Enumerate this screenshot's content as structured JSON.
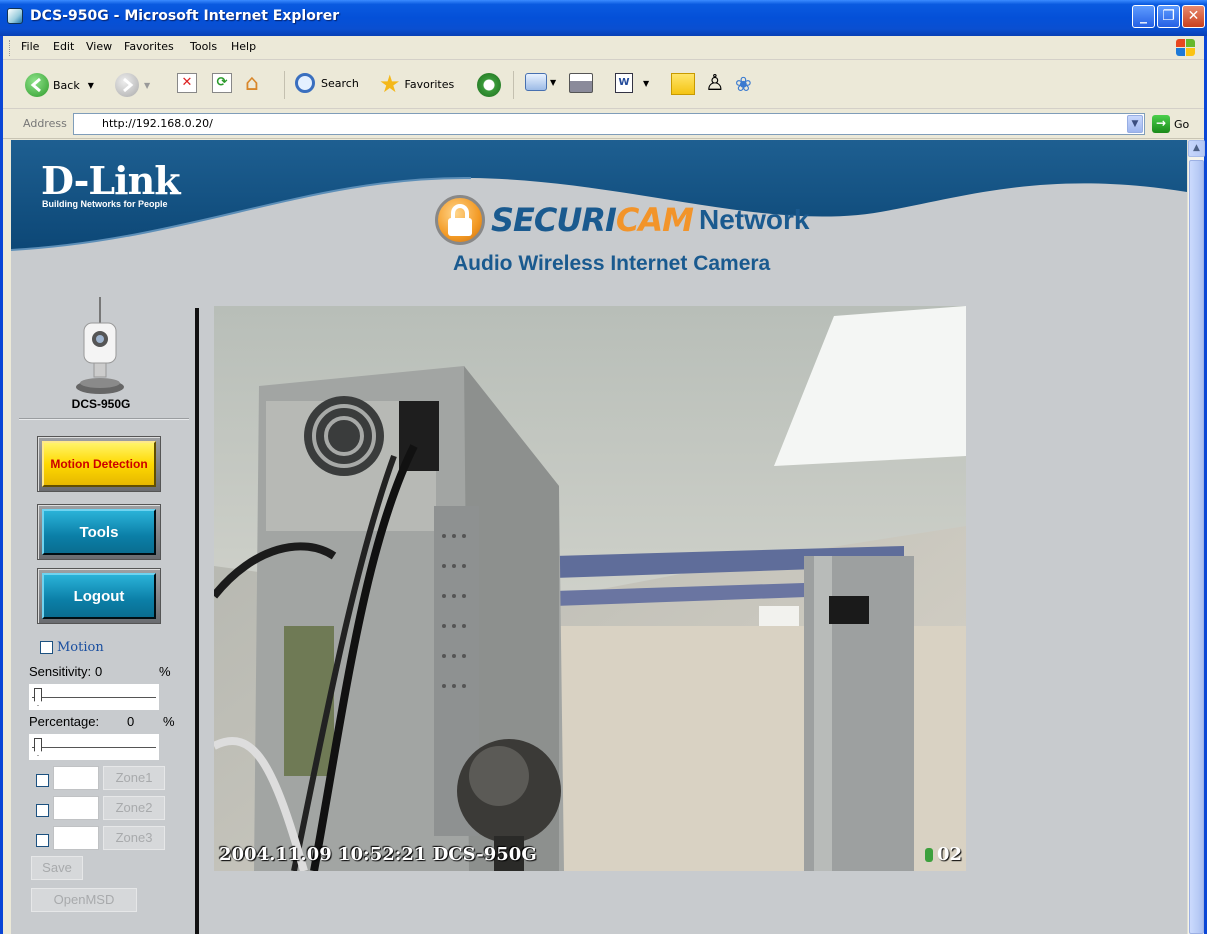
{
  "window": {
    "title": "DCS-950G - Microsoft Internet Explorer"
  },
  "menu": {
    "items": [
      "File",
      "Edit",
      "View",
      "Favorites",
      "Tools",
      "Help"
    ]
  },
  "toolbar": {
    "back_label": "Back",
    "search_label": "Search",
    "favorites_label": "Favorites"
  },
  "address": {
    "label": "Address",
    "url": "http://192.168.0.20/",
    "go_label": "Go"
  },
  "page": {
    "brand": "D-Link",
    "brand_tagline": "Building Networks for People",
    "product_securi": "SECURI",
    "product_cam": "CAM",
    "product_network": "Network",
    "subtitle": "Audio Wireless Internet Camera",
    "model": "DCS-950G"
  },
  "sidebar": {
    "motion_detection_label": "Motion Detection",
    "tools_label": "Tools",
    "logout_label": "Logout",
    "motion_checkbox_label": "Motion",
    "sensitivity_label": "Sensitivity:",
    "sensitivity_value": "0",
    "sensitivity_unit": "%",
    "percentage_label": "Percentage:",
    "percentage_value": "0",
    "percentage_unit": "%",
    "zones": [
      "Zone1",
      "Zone2",
      "Zone3"
    ],
    "save_label": "Save",
    "openmsd_label": "OpenMSD"
  },
  "video": {
    "timestamp_overlay": "2004.11.09 10:52:21 DCS-950G",
    "camera_number": "02"
  },
  "colors": {
    "brand_blue": "#1a5a8f",
    "accent_orange": "#f2942a",
    "nav_yellow": "#ffd900",
    "nav_teal": "#0b7fa7"
  }
}
